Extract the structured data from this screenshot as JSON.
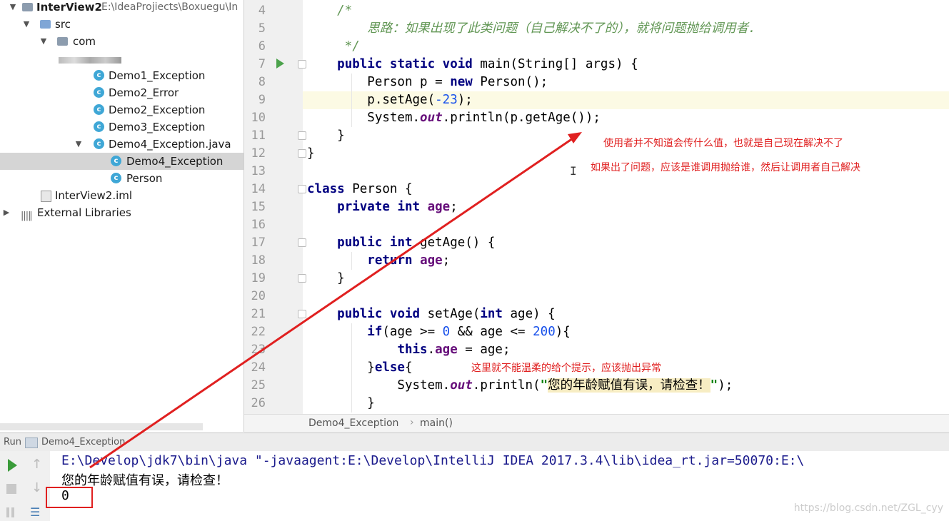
{
  "project": {
    "name": "InterView2",
    "path": "E:\\IdeaProjiects\\Boxuegu\\In",
    "items": [
      {
        "label": "src"
      },
      {
        "label": "com"
      },
      {
        "label": "Demo1_Exception"
      },
      {
        "label": "Demo2_Error"
      },
      {
        "label": "Demo2_Exception"
      },
      {
        "label": "Demo3_Exception"
      },
      {
        "label": "Demo4_Exception.java"
      },
      {
        "label": "Demo4_Exception"
      },
      {
        "label": "Person"
      },
      {
        "label": "InterView2.iml"
      },
      {
        "label": "External Libraries"
      }
    ]
  },
  "editor": {
    "line_numbers": [
      "4",
      "5",
      "6",
      "7",
      "8",
      "9",
      "10",
      "11",
      "12",
      "13",
      "14",
      "15",
      "16",
      "17",
      "18",
      "19",
      "20",
      "21",
      "22",
      "23",
      "24",
      "25",
      "26"
    ],
    "current_line": "9",
    "annotations": [
      "使用者并不知道会传什么值，也就是自己现在解决不了",
      "如果出了问题，应该是谁调用抛给谁，然后让调用者自己解决",
      "这里就不能温柔的给个提示，应该抛出异常"
    ]
  },
  "breadcrumb": [
    "Demo4_Exception",
    "main()"
  ],
  "run": {
    "tab_label": "Run",
    "config": "Demo4_Exception",
    "console_lines": [
      "E:\\Develop\\jdk7\\bin\\java \"-javaagent:E:\\Develop\\IntelliJ IDEA 2017.3.4\\lib\\idea_rt.jar=50070:E:\\",
      "您的年龄赋值有误，请检查！",
      "0"
    ]
  },
  "watermark": "https://blog.csdn.net/ZGL_cyy",
  "colors": {
    "annotation": "#e02020",
    "keyword": "#000080",
    "comment": "#629755"
  }
}
